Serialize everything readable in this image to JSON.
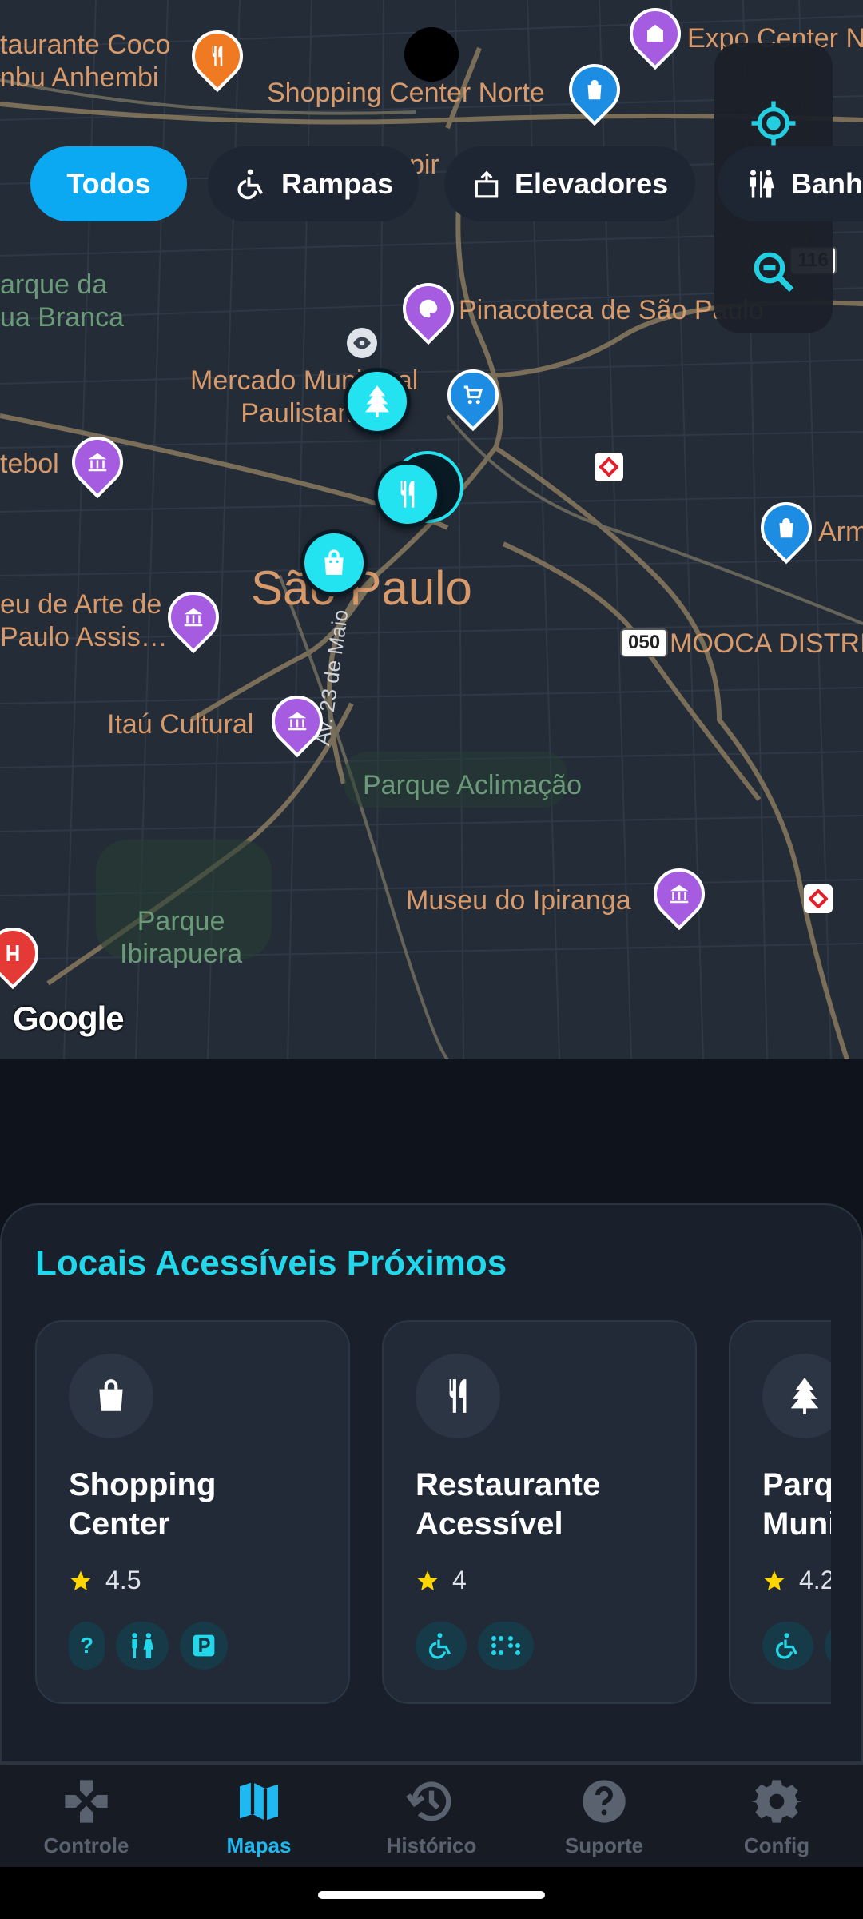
{
  "map": {
    "labels": {
      "restaurant": "taurante Coco\nnbu Anhembi",
      "expo": "Expo Center N",
      "shopping_norte": "Shopping Center Norte",
      "parque_agua_branca": "arque da\nua Branca",
      "pinacoteca": "Pinacoteca de São Paulo",
      "mercado": "Mercado Municipal\nPaulistano",
      "futebol": "tebol",
      "arm": "Arm",
      "sao_paulo": "São Paulo",
      "museu_arte": "eu de Arte de\nPaulo Assis…",
      "mooca": "MOOCA DISTRI",
      "itau": "Itaú Cultural",
      "av_23": "Av. 23 de Maio",
      "aclimacao": "Parque Aclimação",
      "ipiranga": "Museu do Ipiranga",
      "ibirapuera": "Parque\nIbirapuera",
      "pirit": "pir",
      "shield_050": "050",
      "shield_116": "116"
    },
    "google_logo": "Google"
  },
  "filters": {
    "todos": "Todos",
    "rampas": "Rampas",
    "elevadores": "Elevadores",
    "banheiros": "Banh"
  },
  "sheet": {
    "title": "Locais Acessíveis Próximos",
    "cards": [
      {
        "name": "Shopping Center",
        "rating": "4.5",
        "badge_help": "?"
      },
      {
        "name": "Restaurante Acessível",
        "rating": "4"
      },
      {
        "name": "Parque Municipal",
        "rating": "4.2"
      }
    ]
  },
  "nav": {
    "items": [
      "Controle",
      "Mapas",
      "Histórico",
      "Suporte",
      "Config"
    ],
    "active": "Mapas"
  },
  "colors": {
    "accent": "#22d7ea",
    "chip_active": "#0aa9f2",
    "nav_active": "#1fb8f0",
    "star": "#ffd600"
  }
}
